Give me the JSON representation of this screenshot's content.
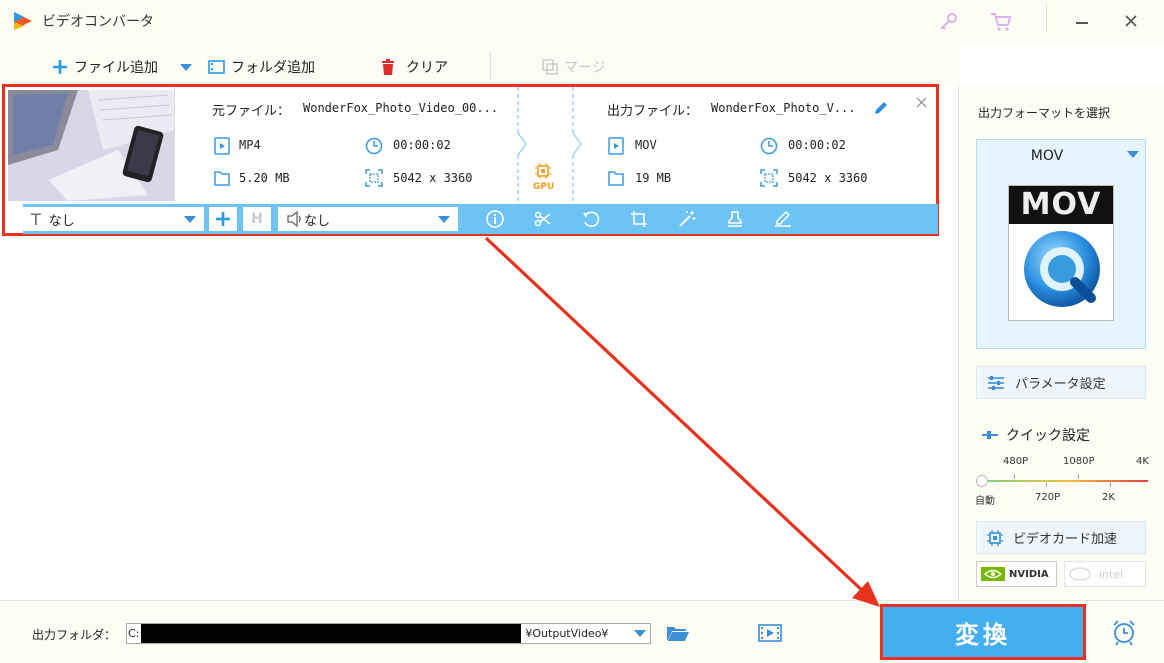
{
  "app": {
    "title": "ビデオコンバータ"
  },
  "toolbar": {
    "add_file": "ファイル追加",
    "add_folder": "フォルダ追加",
    "clear": "クリア",
    "merge": "マージ"
  },
  "file": {
    "source_label": "元ファイル：",
    "source_name": "WonderFox_Photo_Video_00...",
    "source_format": "MP4",
    "source_duration": "00:00:02",
    "source_size": "5.20 MB",
    "source_resolution": "5042 x 3360",
    "gpu": "GPU",
    "output_label": "出力ファイル：",
    "output_name": "WonderFox_Photo_V...",
    "output_format": "MOV",
    "output_duration": "00:00:02",
    "output_size": "19 MB",
    "output_resolution": "5042 x 3360",
    "subtitle": "なし",
    "audio": "なし"
  },
  "panel": {
    "heading": "出力フォーマットを選択",
    "format": "MOV",
    "format_icon_text": "MOV",
    "params": "パラメータ設定",
    "quick": "クイック設定",
    "ticks_top": [
      "480P",
      "1080P",
      "4K"
    ],
    "ticks_bottom": [
      "自動",
      "720P",
      "2K"
    ],
    "gpu_accel": "ビデオカード加速",
    "nvidia": "NVIDIA",
    "intel": "intel"
  },
  "bottom": {
    "output_folder_label": "出力フォルダ：",
    "path_prefix": "C:",
    "path_suffix": "¥OutputVideo¥",
    "convert": "変換"
  }
}
